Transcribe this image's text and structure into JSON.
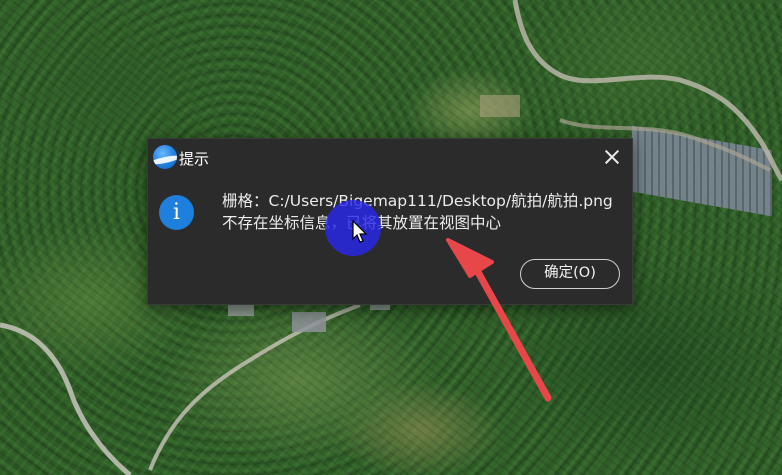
{
  "dialog": {
    "title": "提示",
    "close_icon": "close-icon",
    "info_icon": "info-icon",
    "info_glyph": "i",
    "message_line1": "栅格：C:/Users/Bigemap111/Desktop/航拍/航拍.png",
    "message_line2": "不存在坐标信息，已将其放置在视图中心",
    "ok_label": "确定(O)"
  },
  "overlay": {
    "cursor_highlight_color": "#2828eb",
    "annotation_arrow_color": "#e8474a"
  },
  "colors": {
    "dialog_background": "#2b2b2b",
    "info_icon_blue": "#1e7fdc"
  }
}
